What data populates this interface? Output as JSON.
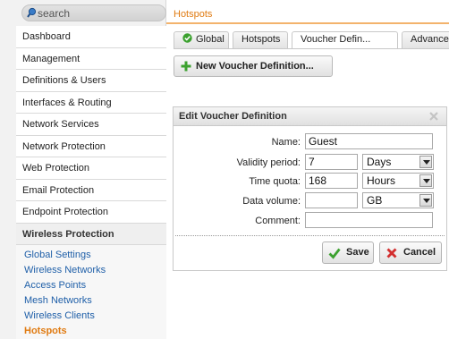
{
  "search": {
    "placeholder": "search"
  },
  "sidebar": {
    "items": [
      "Dashboard",
      "Management",
      "Definitions & Users",
      "Interfaces & Routing",
      "Network Services",
      "Network Protection",
      "Web Protection",
      "Email Protection",
      "Endpoint Protection"
    ],
    "open_section": "Wireless Protection",
    "sub_items": [
      "Global Settings",
      "Wireless Networks",
      "Access Points",
      "Mesh Networks",
      "Wireless Clients",
      "Hotspots"
    ],
    "active_sub_item": "Hotspots"
  },
  "header": {
    "title": "Hotspots"
  },
  "tabs": [
    {
      "label": "Global",
      "icon": "check-circle-icon",
      "active": false
    },
    {
      "label": "Hotspots",
      "active": false
    },
    {
      "label": "Voucher Defin...",
      "active": true
    },
    {
      "label": "Advance",
      "active": false
    }
  ],
  "toolbar": {
    "new_label": "New Voucher Definition..."
  },
  "dialog": {
    "title": "Edit Voucher Definition",
    "fields": {
      "name": {
        "label": "Name:",
        "value": "Guest"
      },
      "validity": {
        "label": "Validity period:",
        "value": "7",
        "unit": "Days"
      },
      "quota": {
        "label": "Time quota:",
        "value": "168",
        "unit": "Hours"
      },
      "volume": {
        "label": "Data volume:",
        "value": "",
        "unit": "GB"
      },
      "comment": {
        "label": "Comment:",
        "value": ""
      }
    },
    "save_label": "Save",
    "cancel_label": "Cancel"
  },
  "colors": {
    "accent": "#e07b12",
    "link": "#1f5fa8",
    "ok_green": "#3ca12f",
    "cancel_red": "#d32f2f"
  }
}
